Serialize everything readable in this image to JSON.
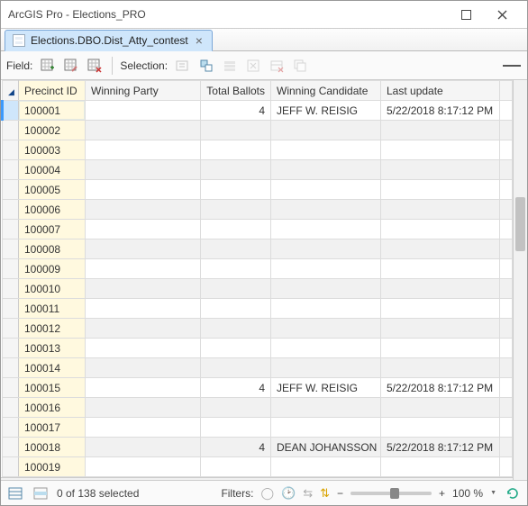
{
  "window": {
    "title": "ArcGIS Pro - Elections_PRO"
  },
  "tab": {
    "label": "Elections.DBO.Dist_Atty_contest"
  },
  "toolbar": {
    "field_label": "Field:",
    "selection_label": "Selection:"
  },
  "columns": [
    "Precinct ID",
    "Winning Party",
    "Total Ballots",
    "Winning Candidate",
    "Last update"
  ],
  "null": "<Null>",
  "rows": [
    {
      "id": "100001",
      "party": "<Null>",
      "ballots": "4",
      "cand": "JEFF W. REISIG",
      "upd": "5/22/2018 8:17:12 PM",
      "sel": true
    },
    {
      "id": "100002",
      "party": "<Null>",
      "ballots": "<Null>",
      "cand": "<Null>",
      "upd": "<Null>"
    },
    {
      "id": "100003",
      "party": "<Null>",
      "ballots": "<Null>",
      "cand": "<Null>",
      "upd": "<Null>"
    },
    {
      "id": "100004",
      "party": "<Null>",
      "ballots": "<Null>",
      "cand": "<Null>",
      "upd": "<Null>"
    },
    {
      "id": "100005",
      "party": "<Null>",
      "ballots": "<Null>",
      "cand": "<Null>",
      "upd": "<Null>"
    },
    {
      "id": "100006",
      "party": "<Null>",
      "ballots": "<Null>",
      "cand": "<Null>",
      "upd": "<Null>"
    },
    {
      "id": "100007",
      "party": "<Null>",
      "ballots": "<Null>",
      "cand": "<Null>",
      "upd": "<Null>"
    },
    {
      "id": "100008",
      "party": "<Null>",
      "ballots": "<Null>",
      "cand": "<Null>",
      "upd": "<Null>"
    },
    {
      "id": "100009",
      "party": "<Null>",
      "ballots": "<Null>",
      "cand": "<Null>",
      "upd": "<Null>"
    },
    {
      "id": "100010",
      "party": "<Null>",
      "ballots": "<Null>",
      "cand": "<Null>",
      "upd": "<Null>"
    },
    {
      "id": "100011",
      "party": "<Null>",
      "ballots": "<Null>",
      "cand": "<Null>",
      "upd": "<Null>"
    },
    {
      "id": "100012",
      "party": "<Null>",
      "ballots": "<Null>",
      "cand": "<Null>",
      "upd": "<Null>"
    },
    {
      "id": "100013",
      "party": "<Null>",
      "ballots": "<Null>",
      "cand": "<Null>",
      "upd": "<Null>"
    },
    {
      "id": "100014",
      "party": "<Null>",
      "ballots": "<Null>",
      "cand": "<Null>",
      "upd": "<Null>"
    },
    {
      "id": "100015",
      "party": "<Null>",
      "ballots": "4",
      "cand": "JEFF W. REISIG",
      "upd": "5/22/2018 8:17:12 PM"
    },
    {
      "id": "100016",
      "party": "<Null>",
      "ballots": "<Null>",
      "cand": "<Null>",
      "upd": "<Null>"
    },
    {
      "id": "100017",
      "party": "<Null>",
      "ballots": "<Null>",
      "cand": "<Null>",
      "upd": "<Null>"
    },
    {
      "id": "100018",
      "party": "<Null>",
      "ballots": "4",
      "cand": "DEAN JOHANSSON",
      "upd": "5/22/2018 8:17:12 PM"
    },
    {
      "id": "100019",
      "party": "<Null>",
      "ballots": "<Null>",
      "cand": "<Null>",
      "upd": "<Null>"
    }
  ],
  "status": {
    "selection_text": "0 of 138 selected",
    "filters_label": "Filters:",
    "zoom_minus": "−",
    "zoom_plus": "+",
    "zoom_pct": "100 %"
  }
}
